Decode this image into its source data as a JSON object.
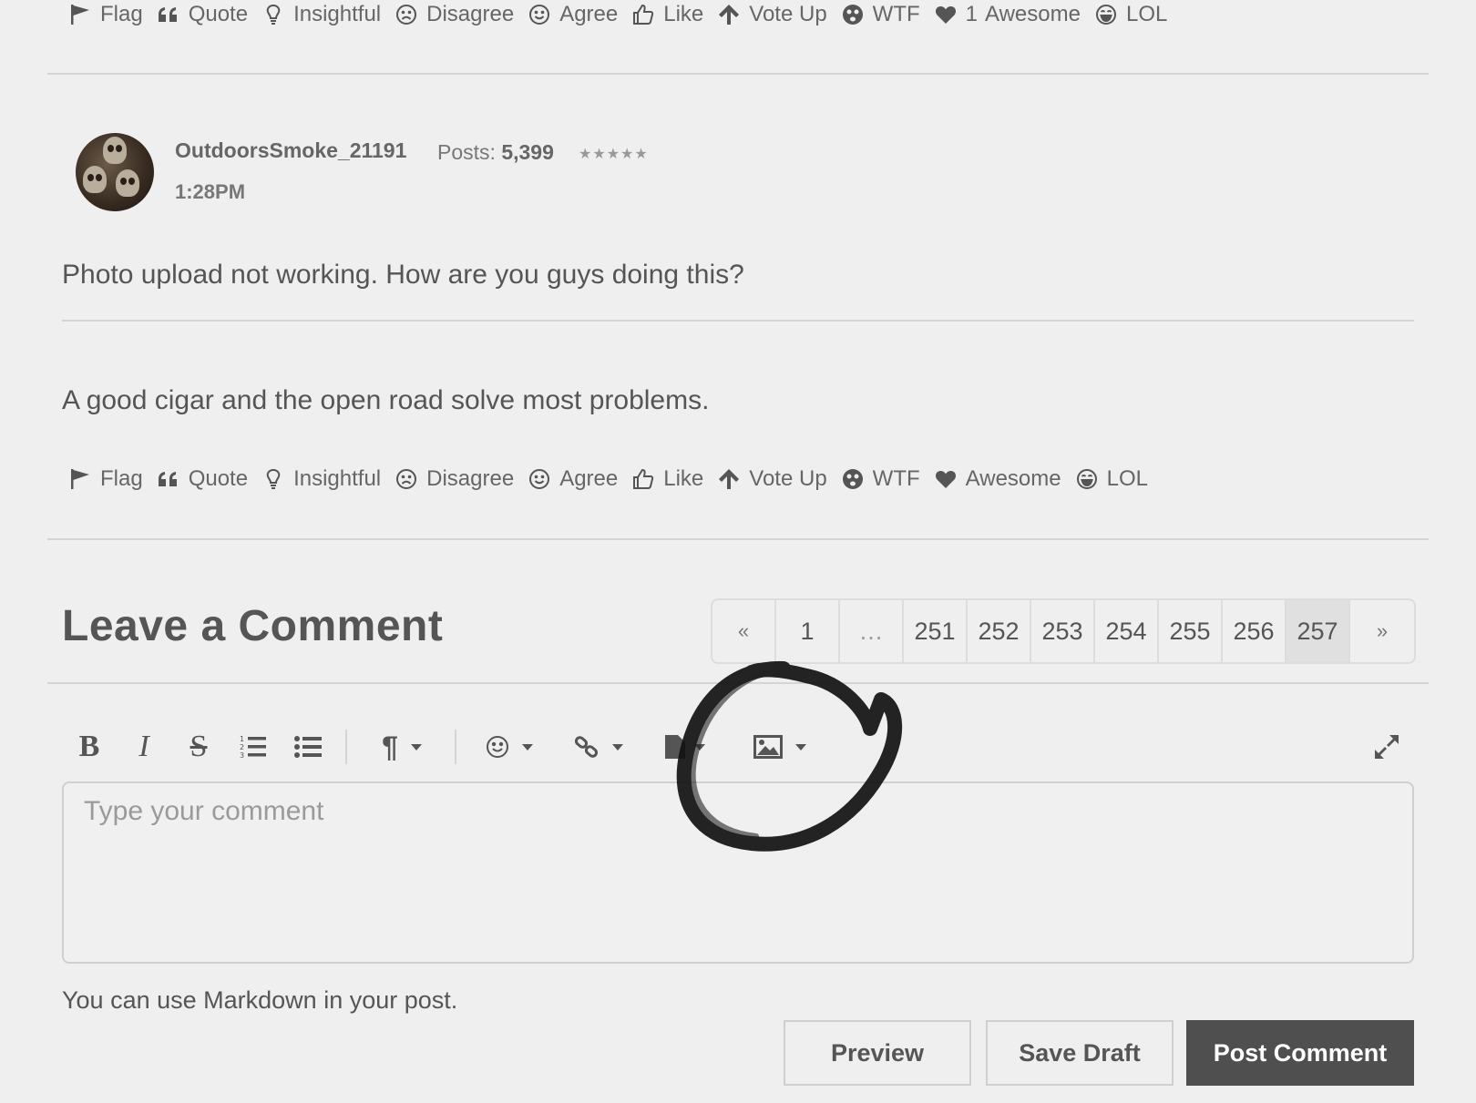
{
  "reactions_top": {
    "items": [
      {
        "label": "Flag",
        "icon": "flag-icon"
      },
      {
        "label": "Quote",
        "icon": "quote-icon"
      },
      {
        "label": "Insightful",
        "icon": "lightbulb-icon"
      },
      {
        "label": "Disagree",
        "icon": "frown-icon"
      },
      {
        "label": "Agree",
        "icon": "smile-icon"
      },
      {
        "label": "Like",
        "icon": "thumbs-up-icon"
      },
      {
        "label": "Vote Up",
        "icon": "arrow-up-icon"
      },
      {
        "label": "WTF",
        "icon": "shocked-icon"
      },
      {
        "label": "Awesome",
        "icon": "heart-icon",
        "count": "1"
      },
      {
        "label": "LOL",
        "icon": "laugh-icon"
      }
    ]
  },
  "post": {
    "username": "OutdoorsSmoke_21191",
    "posts_label": "Posts:",
    "posts_count": "5,399",
    "stars": "★★★★★",
    "time": "1:28PM",
    "body": "Photo upload not working. How are you guys doing this?",
    "signature": "A good cigar and the open road solve most problems."
  },
  "reactions_bottom": {
    "items": [
      {
        "label": "Flag",
        "icon": "flag-icon"
      },
      {
        "label": "Quote",
        "icon": "quote-icon"
      },
      {
        "label": "Insightful",
        "icon": "lightbulb-icon"
      },
      {
        "label": "Disagree",
        "icon": "frown-icon"
      },
      {
        "label": "Agree",
        "icon": "smile-icon"
      },
      {
        "label": "Like",
        "icon": "thumbs-up-icon"
      },
      {
        "label": "Vote Up",
        "icon": "arrow-up-icon"
      },
      {
        "label": "WTF",
        "icon": "shocked-icon"
      },
      {
        "label": "Awesome",
        "icon": "heart-icon"
      },
      {
        "label": "LOL",
        "icon": "laugh-icon"
      }
    ]
  },
  "comment": {
    "title": "Leave a Comment",
    "placeholder": "Type your comment",
    "markdown_prefix": "You can use ",
    "markdown_link": "Markdown",
    "markdown_suffix": " in your post.",
    "preview": "Preview",
    "save_draft": "Save Draft",
    "post": "Post Comment"
  },
  "pagination": {
    "prev": "«",
    "pages": [
      "1",
      "…",
      "251",
      "252",
      "253",
      "254",
      "255",
      "256",
      "257"
    ],
    "current": "257",
    "next": "»"
  },
  "toolbar": {
    "bold": "B",
    "italic": "I",
    "strike": "S",
    "paragraph": "¶"
  }
}
